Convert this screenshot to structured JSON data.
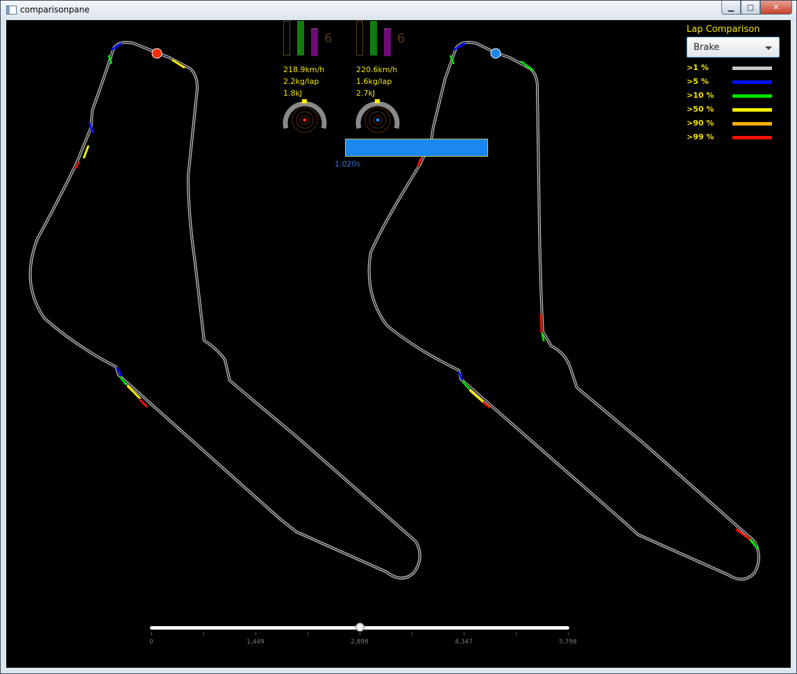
{
  "window": {
    "title": "comparisonpane"
  },
  "cars": [
    {
      "speed": "218.9km/h",
      "fuel": "2.2kg/lap",
      "energy": "1.8kJ",
      "gear": "6",
      "marker_color": "#ff2a00"
    },
    {
      "speed": "220.6km/h",
      "fuel": "1.6kg/lap",
      "energy": "2.7kJ",
      "gear": "6",
      "marker_color": "#1a87ee"
    }
  ],
  "delta": {
    "time": "1.020s",
    "color": "#1a87ee"
  },
  "legend": {
    "title": "Lap Comparison",
    "selected_channel": "Brake",
    "items": [
      {
        "label": ">1 %",
        "color": "#c8c8c8"
      },
      {
        "label": ">5 %",
        "color": "#0010ff"
      },
      {
        "label": ">10 %",
        "color": "#00e000"
      },
      {
        "label": ">50 %",
        "color": "#fff200"
      },
      {
        "label": ">90 %",
        "color": "#ffb000"
      },
      {
        "label": ">99 %",
        "color": "#ff1000"
      }
    ]
  },
  "slider": {
    "min": 0,
    "max": 5798,
    "value": 2898,
    "tick_labels": [
      "0",
      "1,449",
      "2,898",
      "4,347",
      "5,798"
    ]
  }
}
